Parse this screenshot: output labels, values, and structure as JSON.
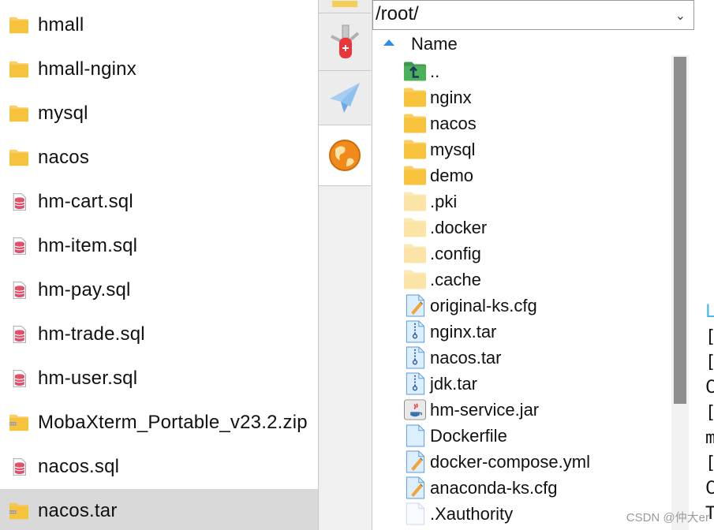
{
  "local_files": [
    {
      "name": "hmall",
      "type": "folder"
    },
    {
      "name": "hmall-nginx",
      "type": "folder"
    },
    {
      "name": "mysql",
      "type": "folder"
    },
    {
      "name": "nacos",
      "type": "folder"
    },
    {
      "name": "hm-cart.sql",
      "type": "sql"
    },
    {
      "name": "hm-item.sql",
      "type": "sql"
    },
    {
      "name": "hm-pay.sql",
      "type": "sql"
    },
    {
      "name": "hm-trade.sql",
      "type": "sql"
    },
    {
      "name": "hm-user.sql",
      "type": "sql"
    },
    {
      "name": "MobaXterm_Portable_v23.2.zip",
      "type": "zip"
    },
    {
      "name": "nacos.sql",
      "type": "sql"
    },
    {
      "name": "nacos.tar",
      "type": "zip",
      "selected": true
    }
  ],
  "side_tabs": [
    {
      "icon": "swiss-knife-icon"
    },
    {
      "icon": "paper-plane-icon"
    },
    {
      "icon": "globe-icon",
      "active": true
    }
  ],
  "remote": {
    "path": "/root/",
    "column_header": "Name",
    "files": [
      {
        "name": "..",
        "type": "parent"
      },
      {
        "name": "nginx",
        "type": "folder"
      },
      {
        "name": "nacos",
        "type": "folder"
      },
      {
        "name": "mysql",
        "type": "folder"
      },
      {
        "name": "demo",
        "type": "folder"
      },
      {
        "name": ".pki",
        "type": "hidden-folder"
      },
      {
        "name": ".docker",
        "type": "hidden-folder"
      },
      {
        "name": ".config",
        "type": "hidden-folder"
      },
      {
        "name": ".cache",
        "type": "hidden-folder"
      },
      {
        "name": "original-ks.cfg",
        "type": "text"
      },
      {
        "name": "nginx.tar",
        "type": "archive"
      },
      {
        "name": "nacos.tar",
        "type": "archive"
      },
      {
        "name": "jdk.tar",
        "type": "archive"
      },
      {
        "name": "hm-service.jar",
        "type": "jar"
      },
      {
        "name": "Dockerfile",
        "type": "doc"
      },
      {
        "name": "docker-compose.yml",
        "type": "text"
      },
      {
        "name": "anaconda-ks.cfg",
        "type": "text"
      },
      {
        "name": ".Xauthority",
        "type": "blank"
      }
    ]
  },
  "terminal_chars": [
    "L",
    "[",
    "[",
    "C",
    "[",
    "m",
    "[",
    "C",
    "T"
  ],
  "colors": {
    "folder": "#f7c33c",
    "hidden_folder": "#fbe4a6",
    "sql_red": "#e0506b",
    "selected_row": "#d9d9d9",
    "sort_arrow": "#2e8fe0",
    "scroll_thumb": "#8e8e8e",
    "terminal_first": "#3fb6e8"
  },
  "watermark": "CSDN @仲大er"
}
